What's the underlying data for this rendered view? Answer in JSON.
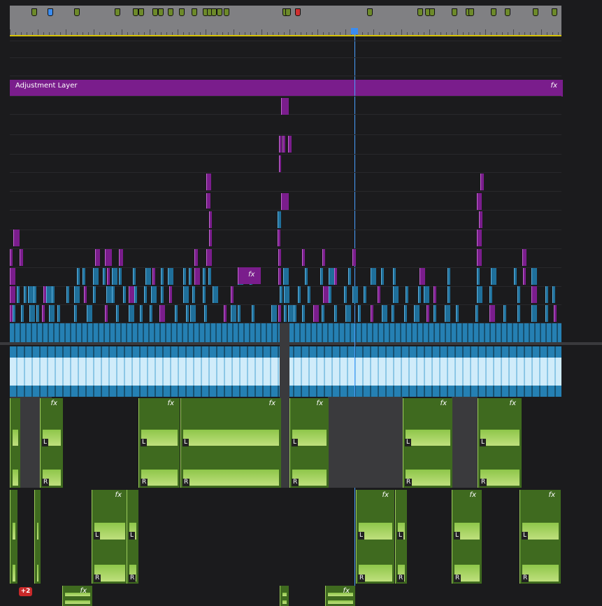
{
  "colors": {
    "video": "#1f6f9a",
    "pink": "#7a1d8c",
    "audio": "#3f6a1f",
    "playhead": "#4aa0ff",
    "marker_green": "#6d8a2a",
    "marker_blue": "#3a8cf0",
    "marker_red": "#d03030"
  },
  "ruler": {
    "marker_icons": [
      "marker-icon"
    ]
  },
  "adjustment_layer": {
    "label": "Adjustment Layer",
    "fx": "fx"
  },
  "clip_fx": "fx",
  "audio": {
    "left": "L",
    "right": "R",
    "levels_icon": "waveform-icon"
  },
  "badge": {
    "label": "+2"
  }
}
